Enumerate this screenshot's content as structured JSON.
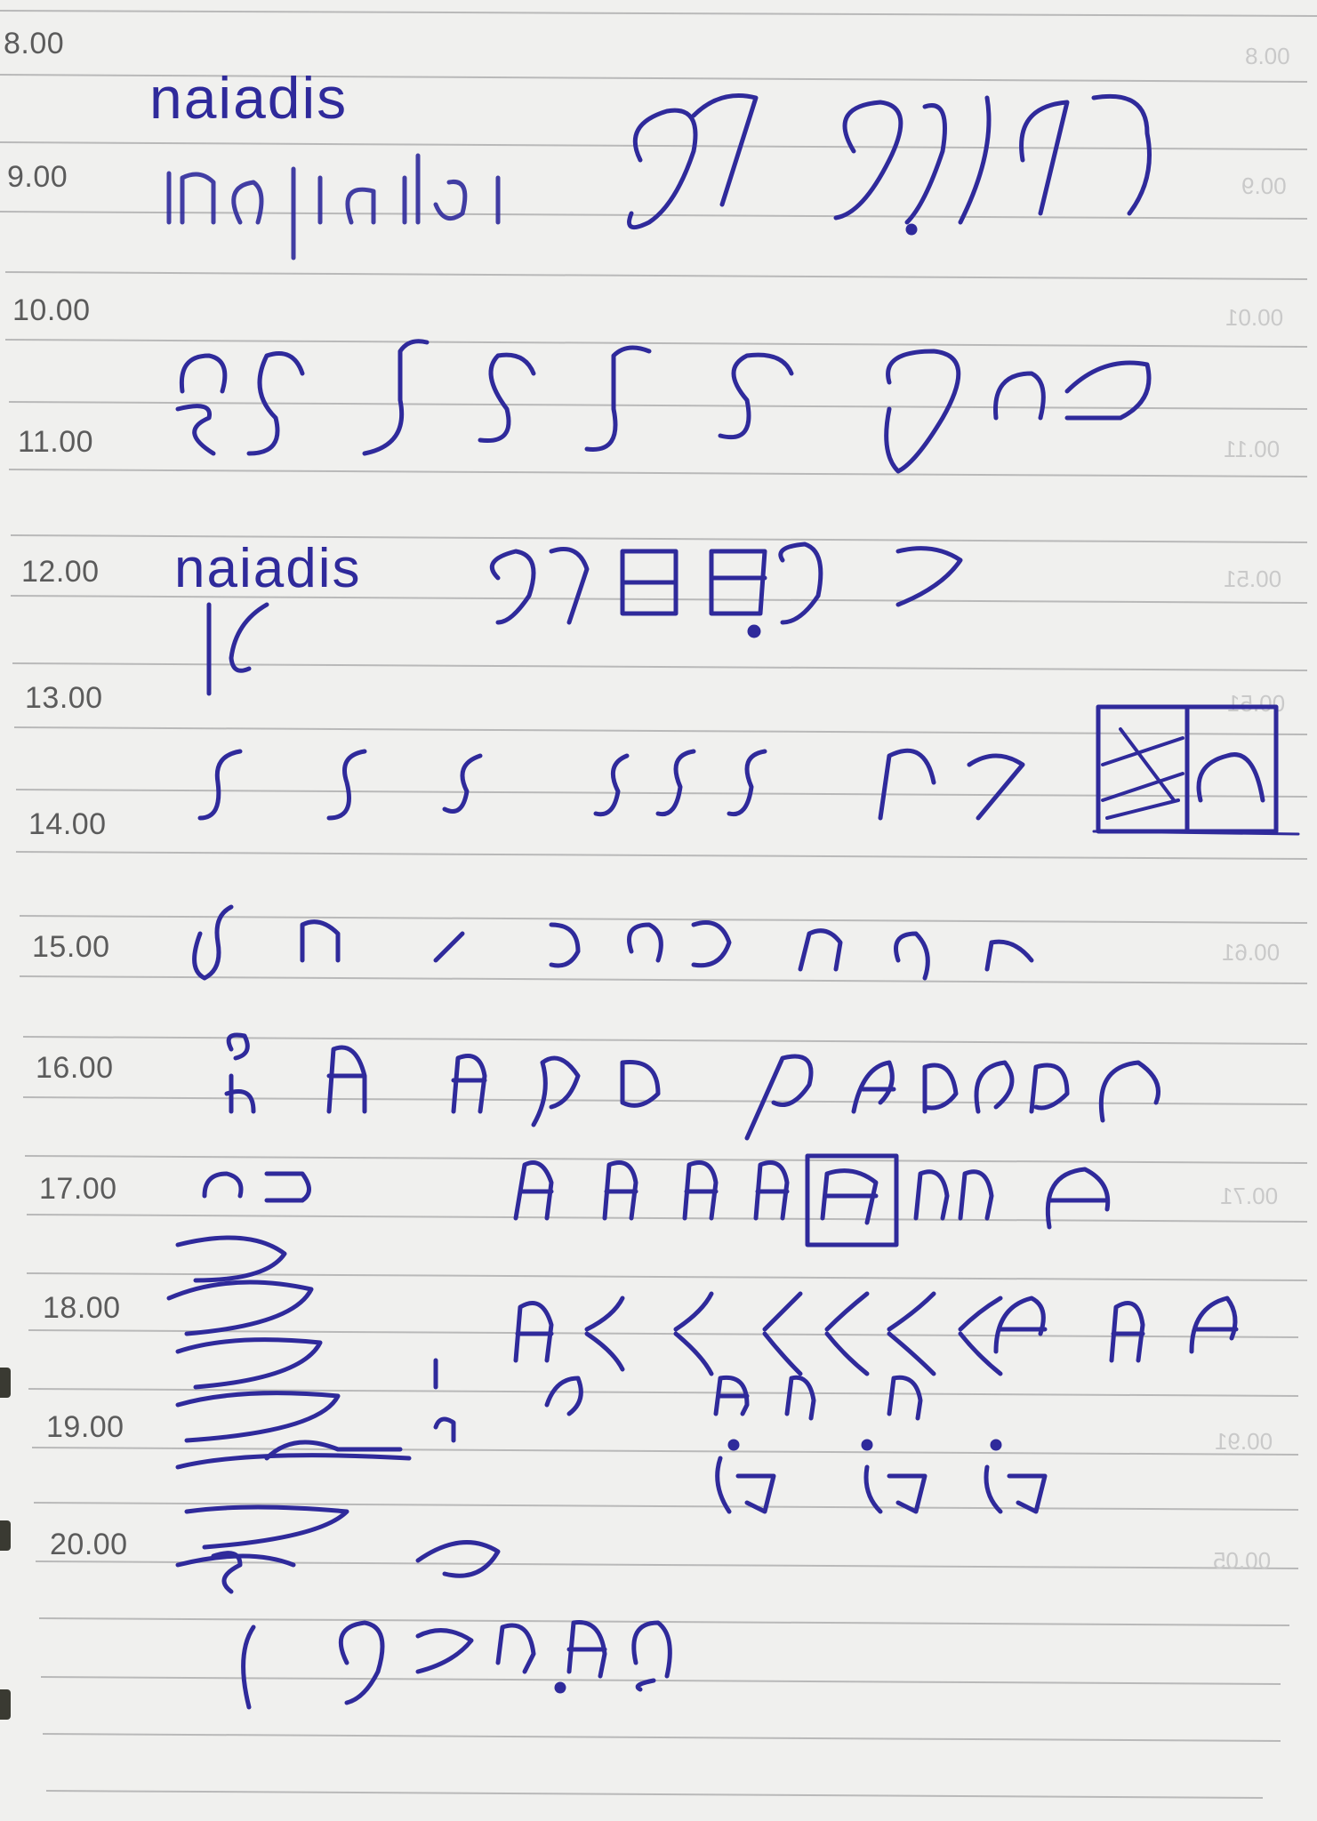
{
  "planner": {
    "times": [
      "8.00",
      "9.00",
      "10.00",
      "11.00",
      "12.00",
      "13.00",
      "14.00",
      "15.00",
      "16.00",
      "17.00",
      "18.00",
      "19.00",
      "20.00"
    ],
    "bleed_through_times": [
      "00.8",
      "00.9",
      "00.01",
      "00.11",
      "00.51",
      "00.51",
      "00.61",
      "00.71",
      "00.91",
      "00.05"
    ]
  },
  "handwriting": {
    "word_top": "naiadis",
    "word_mid": "naiadis",
    "ink_color": "#2f2a9b"
  }
}
